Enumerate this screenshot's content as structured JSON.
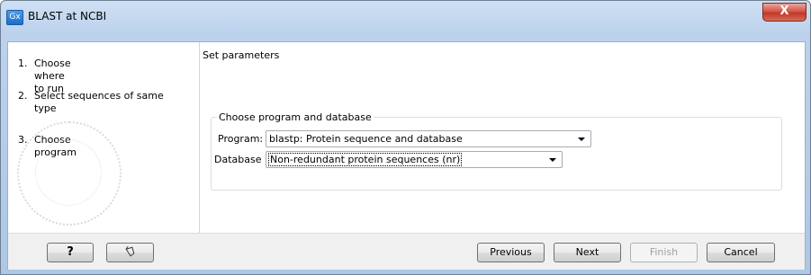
{
  "window": {
    "app_icon": "Gx",
    "title": "BLAST at NCBI",
    "close_glyph": "X"
  },
  "steps": [
    {
      "num": "1.",
      "label": "Choose where to run"
    },
    {
      "num": "2.",
      "label": "Select sequences of same type"
    },
    {
      "num": "3.",
      "label": "Choose program"
    }
  ],
  "content": {
    "page_title": "Set parameters",
    "group_title": "Choose program and database",
    "program_label": "Program:",
    "program_value": "blastp: Protein sequence and database",
    "database_label": "Database",
    "database_value": "Non-redundant protein sequences (nr)"
  },
  "buttons": {
    "help": "?",
    "reset_icon": "undo-hand-icon",
    "previous": "Previous",
    "next": "Next",
    "finish": "Finish",
    "cancel": "Cancel"
  }
}
